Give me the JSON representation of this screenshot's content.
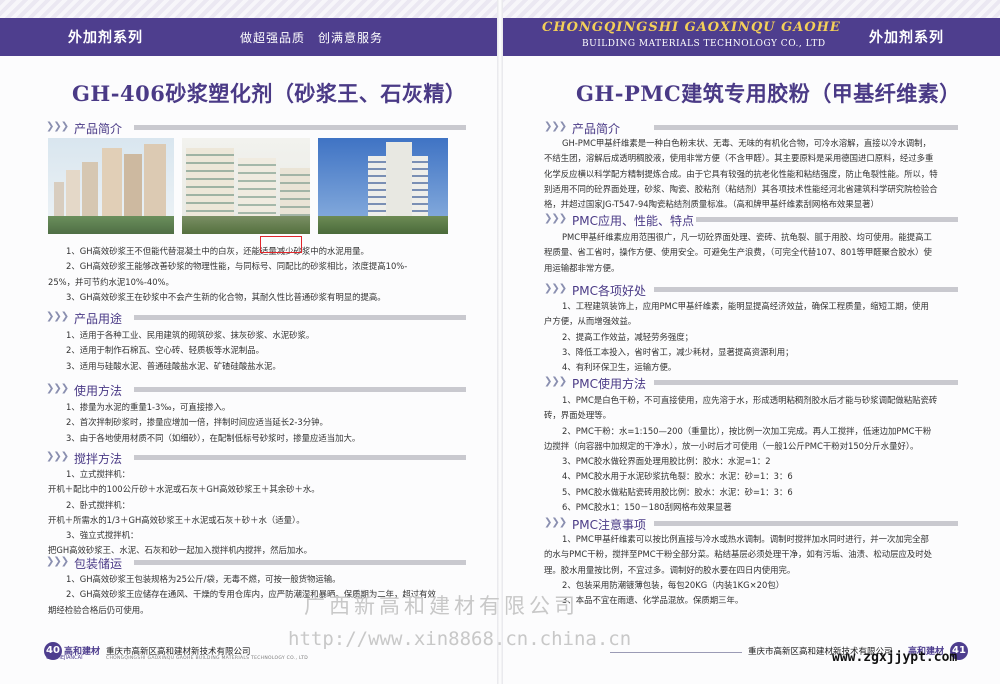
{
  "left": {
    "series_title": "外加剂系列",
    "slogan": "做超强品质　创满意服务",
    "heading": "GH-406砂浆塑化剂（砂浆王、石灰精）",
    "sections": {
      "intro": "产品简介",
      "usage": "产品用途",
      "method": "使用方法",
      "mixing": "搅拌方法",
      "storage": "包装储运"
    },
    "intro_lines": [
      "1、GH高效砂浆王不但能代替混凝土中的白灰，还能适量减少砂浆中的水泥用量。",
      "2、GH高效砂浆王能够改善砂浆的物理性能，与同标号、同配比的砂浆相比，浓度提高10%-",
      "25%，并可节约水泥10%-40%。",
      "3、GH高效砂浆王在砂浆中不会产生新的化合物，其耐久性比普通砂浆有明显的提高。"
    ],
    "usage_lines": [
      "1、适用于各种工业、民用建筑的砌筑砂浆、抹灰砂浆、水泥砂浆。",
      "2、适用于制作石棉瓦、空心砖、轻质板等水泥制品。",
      "3、适用与硅酸水泥、普通硅酸盐水泥、矿碴硅酸盐水泥。"
    ],
    "method_lines": [
      "1、掺量为水泥的重量1-3‰，可直接掺入。",
      "2、首次拌制砂浆时，掺量应增加一倍，拌制时间应适当延长2-3分钟。",
      "3、由于各地使用材质不同（如细砂），在配制低标号砂浆时，掺量应适当加大。"
    ],
    "mixing_lines": [
      "1、立式搅拌机：",
      "开机＋配比中的100公斤砂＋水泥或石灰＋GH高效砂浆王＋其余砂＋水。",
      "2、卧式搅拌机：",
      "开机＋所需水的1/3＋GH高效砂浆王＋水泥或石灰＋砂＋水（适量）。",
      "3、強立式搅拌机：",
      "把GH高效砂浆王、水泥、石灰和砂一起加入搅拌机内搅拌，然后加水。"
    ],
    "storage_lines": [
      "1、GH高效砂浆王包装规格为25公斤/袋，无毒不燃，可按一般货物运输。",
      "2、GH高效砂浆王应储存在通风、干燥的专用仓库内，应严防潮湿和暴晒。保质期为二年，超过有效",
      "期经检验合格后仍可使用。"
    ],
    "footer": {
      "page": "40",
      "brand": "高和建材",
      "brand_en": "GAOHEJIANCAI",
      "company": "重庆市高新区高和建材新技术有限公司",
      "company_en": "CHONGQINGSHI GAOXINQU GAOHE BUILDING MATERIALS TECHNOLOGY CO., LTD"
    }
  },
  "right": {
    "series_title": "外加剂系列",
    "company_en_line1": "CHONGQINGSHI GAOXINQU GAOHE",
    "company_en_line2": "BUILDING MATERIALS TECHNOLOGY CO., LTD",
    "heading": "GH-PMC建筑专用胶粉（甲基纤维素）",
    "sections": {
      "intro": "产品简介",
      "application": "PMC应用、性能、特点",
      "benefits": "PMC各项好处",
      "method": "PMC使用方法",
      "notes": "PMC注意事项"
    },
    "intro_lines": [
      "GH-PMC甲基纤维素是一种白色粉末状、无毒、无味的有机化合物，可冷水溶解，直接以冷水调制，",
      "不结生团，溶解后成透明稠胶液，使用非常方便（不含甲醛）。其主要原料是采用德国进口原料，经过多重",
      "化学反应横以科学配方精制提炼合成。由于它具有较强的抗老化性能和粘结强度，防止龟裂性能。所以，特",
      "别适用不同的砼界面处理，砂浆、陶瓷、胶粘剂（粘结剂）其各项技术性能经河北省建筑科学研究院检验合",
      "格，并超过国家JG-T547-94陶瓷粘结剂质量标准。（高和牌甲基纤维素刮网格布效果显著）"
    ],
    "application_lines": [
      "PMC甲基纤维素应用范围很广，凡一切砼界面处理、瓷砖、抗龟裂、腻于用胶、均可使用。能提高工",
      "程质量、省工省时，操作方便、使用安全。可避免生产浪费，（可完全代替107、801等甲醛聚合胶水）使",
      "用运输都非常方便。"
    ],
    "benefit_lines": [
      "1、工程建筑装饰上，应用PMC甲基纤维素，能明显提高经济效益，确保工程质量，缩短工期，使用",
      "户方便，从而增强效益。",
      "2、提高工作效益，减轻劳务强度；",
      "3、降低工本投入，省时省工，减少耗材，显著提高资源利用；",
      "4、有利环保卫生，运输方便。"
    ],
    "method_lines": [
      "1、PMC是白色干粉，不可直接使用，应先溶于水，形成透明粘稠剂胶水后才能与砂浆调配做粘贴瓷砖",
      "砖，界面处理等。",
      "2、PMC干粉：水=1:150—200（重量比），按比例一次加工完成。再人工搅拌，低速边加PMC干粉",
      "边搅拌（向容器中加规定的干净水），放一小时后才可使用（一般1公斤PMC干粉对150分斤水量好）。",
      "3、PMC胶水做砼界面处理用胶比例：胶水：水泥=1：2",
      "4、PMC胶水用于水泥砂浆抗龟裂：胶水：水泥：砂=1：3：6",
      "5、PMC胶水做粘贴瓷砖用胶比例：胶水：水泥：砂=1：3：6",
      "6、PMC胶水1：150－180刮网格布效果显著"
    ],
    "notes_lines": [
      "1、PMC甲基纤维素可以按比例直接与冷水或热水调制。调制时搅拌加水同时进行，并一次加完全部",
      "的水与PMC干粉，搅拌至PMC干粉全部分菜。粘结基层必须处理干净，如有污垢、油渍、松动层应及时处",
      "理。胶水用量按比例，不宜过多。调制好的胶水要在四日内使用完。",
      "2、包装采用防潮镀薄包装，每包20KG（内装1KG×20包）",
      "3、本品不宜在雨遗、化学品混放。保质期三年。"
    ],
    "footer": {
      "page": "41",
      "brand": "高和建材",
      "company": "重庆市高新区高和建材新技术有限公司"
    }
  },
  "watermarks": {
    "line1": "广西新高和建材有限公司",
    "line2": "http://www.xin8868.cn.china.cn",
    "line3": "www.zgxjjypt.com"
  }
}
